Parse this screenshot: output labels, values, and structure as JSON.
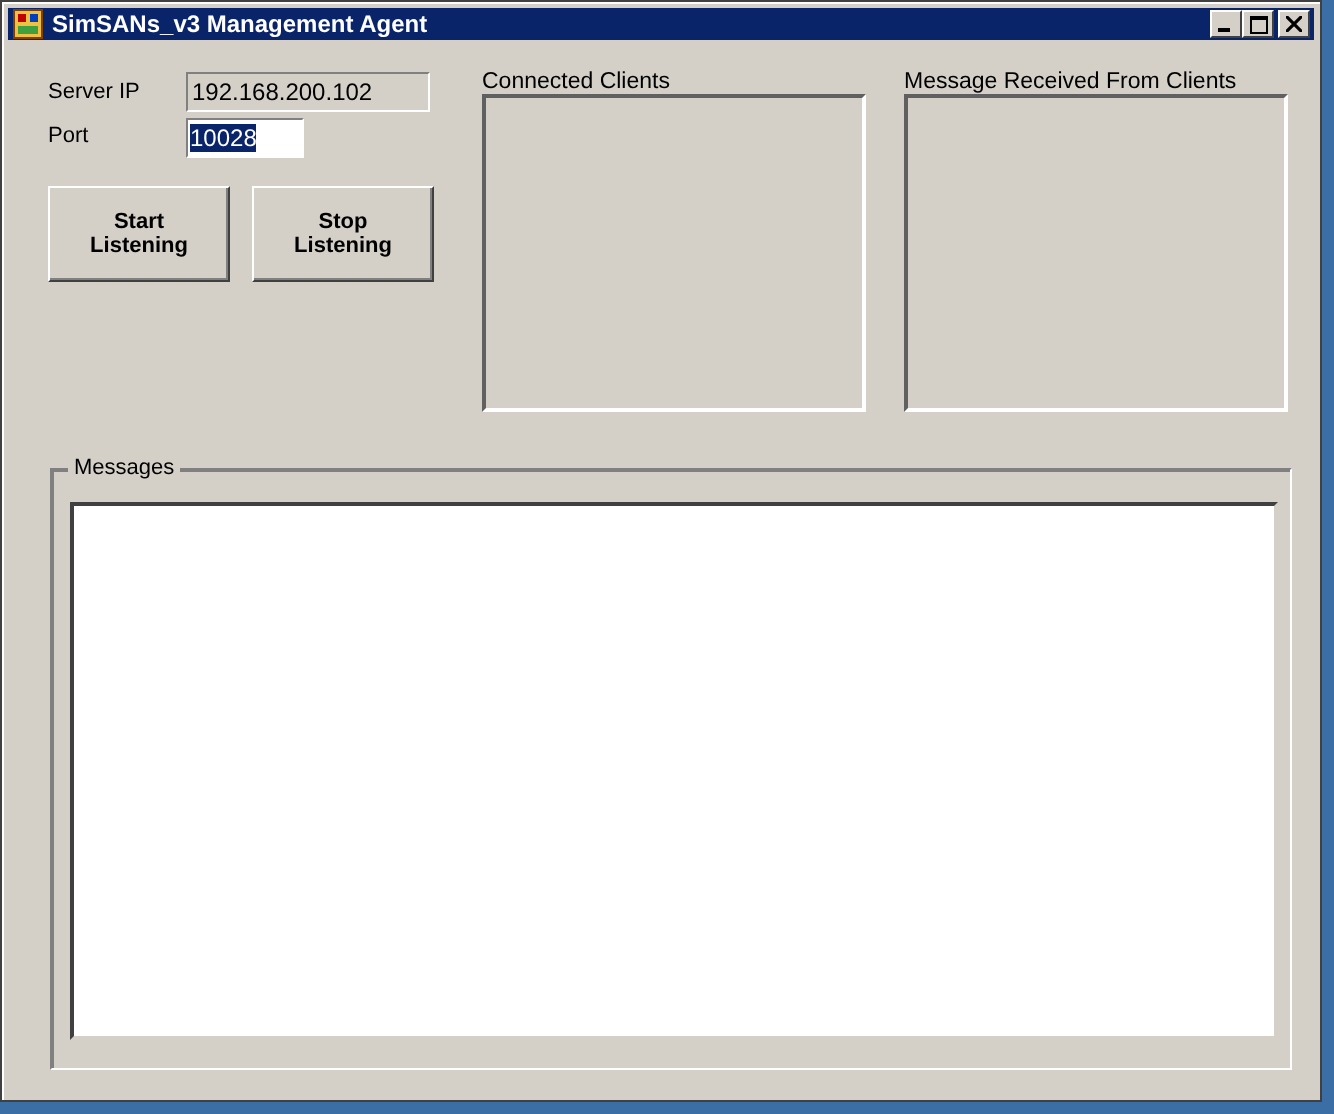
{
  "window": {
    "title": "SimSANs_v3 Management Agent"
  },
  "server_ip": {
    "label": "Server IP",
    "value": "192.168.200.102",
    "disabled": true
  },
  "port": {
    "label": "Port",
    "value": "10028",
    "text_selected": true
  },
  "buttons": [
    {
      "label": "Start Listening"
    },
    {
      "label": "Stop Listening"
    }
  ],
  "lists": [
    {
      "label": "Connected Clients"
    },
    {
      "label": "Message Received From Clients"
    }
  ],
  "messages": {
    "label": "Messages"
  }
}
